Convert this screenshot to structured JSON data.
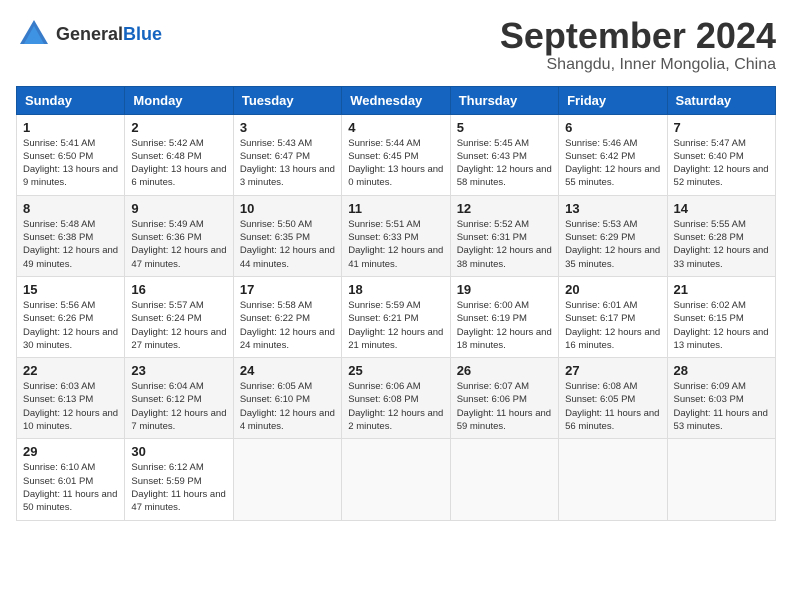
{
  "logo": {
    "general": "General",
    "blue": "Blue"
  },
  "header": {
    "month": "September 2024",
    "location": "Shangdu, Inner Mongolia, China"
  },
  "weekdays": [
    "Sunday",
    "Monday",
    "Tuesday",
    "Wednesday",
    "Thursday",
    "Friday",
    "Saturday"
  ],
  "days": [
    {
      "num": "1",
      "sunrise": "5:41 AM",
      "sunset": "6:50 PM",
      "daylight": "13 hours and 9 minutes."
    },
    {
      "num": "2",
      "sunrise": "5:42 AM",
      "sunset": "6:48 PM",
      "daylight": "13 hours and 6 minutes."
    },
    {
      "num": "3",
      "sunrise": "5:43 AM",
      "sunset": "6:47 PM",
      "daylight": "13 hours and 3 minutes."
    },
    {
      "num": "4",
      "sunrise": "5:44 AM",
      "sunset": "6:45 PM",
      "daylight": "13 hours and 0 minutes."
    },
    {
      "num": "5",
      "sunrise": "5:45 AM",
      "sunset": "6:43 PM",
      "daylight": "12 hours and 58 minutes."
    },
    {
      "num": "6",
      "sunrise": "5:46 AM",
      "sunset": "6:42 PM",
      "daylight": "12 hours and 55 minutes."
    },
    {
      "num": "7",
      "sunrise": "5:47 AM",
      "sunset": "6:40 PM",
      "daylight": "12 hours and 52 minutes."
    },
    {
      "num": "8",
      "sunrise": "5:48 AM",
      "sunset": "6:38 PM",
      "daylight": "12 hours and 49 minutes."
    },
    {
      "num": "9",
      "sunrise": "5:49 AM",
      "sunset": "6:36 PM",
      "daylight": "12 hours and 47 minutes."
    },
    {
      "num": "10",
      "sunrise": "5:50 AM",
      "sunset": "6:35 PM",
      "daylight": "12 hours and 44 minutes."
    },
    {
      "num": "11",
      "sunrise": "5:51 AM",
      "sunset": "6:33 PM",
      "daylight": "12 hours and 41 minutes."
    },
    {
      "num": "12",
      "sunrise": "5:52 AM",
      "sunset": "6:31 PM",
      "daylight": "12 hours and 38 minutes."
    },
    {
      "num": "13",
      "sunrise": "5:53 AM",
      "sunset": "6:29 PM",
      "daylight": "12 hours and 35 minutes."
    },
    {
      "num": "14",
      "sunrise": "5:55 AM",
      "sunset": "6:28 PM",
      "daylight": "12 hours and 33 minutes."
    },
    {
      "num": "15",
      "sunrise": "5:56 AM",
      "sunset": "6:26 PM",
      "daylight": "12 hours and 30 minutes."
    },
    {
      "num": "16",
      "sunrise": "5:57 AM",
      "sunset": "6:24 PM",
      "daylight": "12 hours and 27 minutes."
    },
    {
      "num": "17",
      "sunrise": "5:58 AM",
      "sunset": "6:22 PM",
      "daylight": "12 hours and 24 minutes."
    },
    {
      "num": "18",
      "sunrise": "5:59 AM",
      "sunset": "6:21 PM",
      "daylight": "12 hours and 21 minutes."
    },
    {
      "num": "19",
      "sunrise": "6:00 AM",
      "sunset": "6:19 PM",
      "daylight": "12 hours and 18 minutes."
    },
    {
      "num": "20",
      "sunrise": "6:01 AM",
      "sunset": "6:17 PM",
      "daylight": "12 hours and 16 minutes."
    },
    {
      "num": "21",
      "sunrise": "6:02 AM",
      "sunset": "6:15 PM",
      "daylight": "12 hours and 13 minutes."
    },
    {
      "num": "22",
      "sunrise": "6:03 AM",
      "sunset": "6:13 PM",
      "daylight": "12 hours and 10 minutes."
    },
    {
      "num": "23",
      "sunrise": "6:04 AM",
      "sunset": "6:12 PM",
      "daylight": "12 hours and 7 minutes."
    },
    {
      "num": "24",
      "sunrise": "6:05 AM",
      "sunset": "6:10 PM",
      "daylight": "12 hours and 4 minutes."
    },
    {
      "num": "25",
      "sunrise": "6:06 AM",
      "sunset": "6:08 PM",
      "daylight": "12 hours and 2 minutes."
    },
    {
      "num": "26",
      "sunrise": "6:07 AM",
      "sunset": "6:06 PM",
      "daylight": "11 hours and 59 minutes."
    },
    {
      "num": "27",
      "sunrise": "6:08 AM",
      "sunset": "6:05 PM",
      "daylight": "11 hours and 56 minutes."
    },
    {
      "num": "28",
      "sunrise": "6:09 AM",
      "sunset": "6:03 PM",
      "daylight": "11 hours and 53 minutes."
    },
    {
      "num": "29",
      "sunrise": "6:10 AM",
      "sunset": "6:01 PM",
      "daylight": "11 hours and 50 minutes."
    },
    {
      "num": "30",
      "sunrise": "6:12 AM",
      "sunset": "5:59 PM",
      "daylight": "11 hours and 47 minutes."
    }
  ],
  "labels": {
    "sunrise": "Sunrise:",
    "sunset": "Sunset:",
    "daylight": "Daylight:"
  }
}
